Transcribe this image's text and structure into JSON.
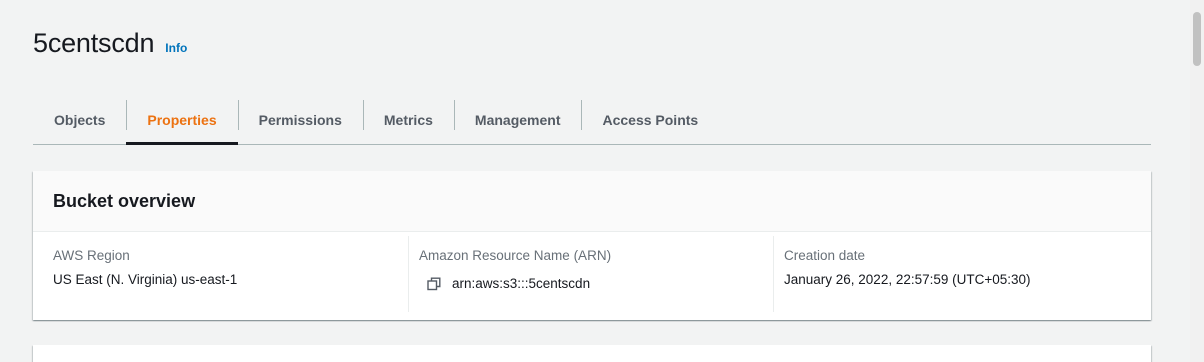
{
  "header": {
    "title": "5centscdn",
    "info_label": "Info"
  },
  "tabs": [
    {
      "label": "Objects",
      "active": false
    },
    {
      "label": "Properties",
      "active": true
    },
    {
      "label": "Permissions",
      "active": false
    },
    {
      "label": "Metrics",
      "active": false
    },
    {
      "label": "Management",
      "active": false
    },
    {
      "label": "Access Points",
      "active": false
    }
  ],
  "bucket_overview": {
    "title": "Bucket overview",
    "region_label": "AWS Region",
    "region_value": "US East (N. Virginia) us-east-1",
    "arn_label": "Amazon Resource Name (ARN)",
    "arn_value": "arn:aws:s3:::5centscdn",
    "created_label": "Creation date",
    "created_value": "January 26, 2022, 22:57:59 (UTC+05:30)"
  },
  "icons": {
    "copy": "copy-icon"
  },
  "colors": {
    "active_tab": "#ec7211",
    "link": "#0073bb",
    "background": "#f2f3f3"
  }
}
